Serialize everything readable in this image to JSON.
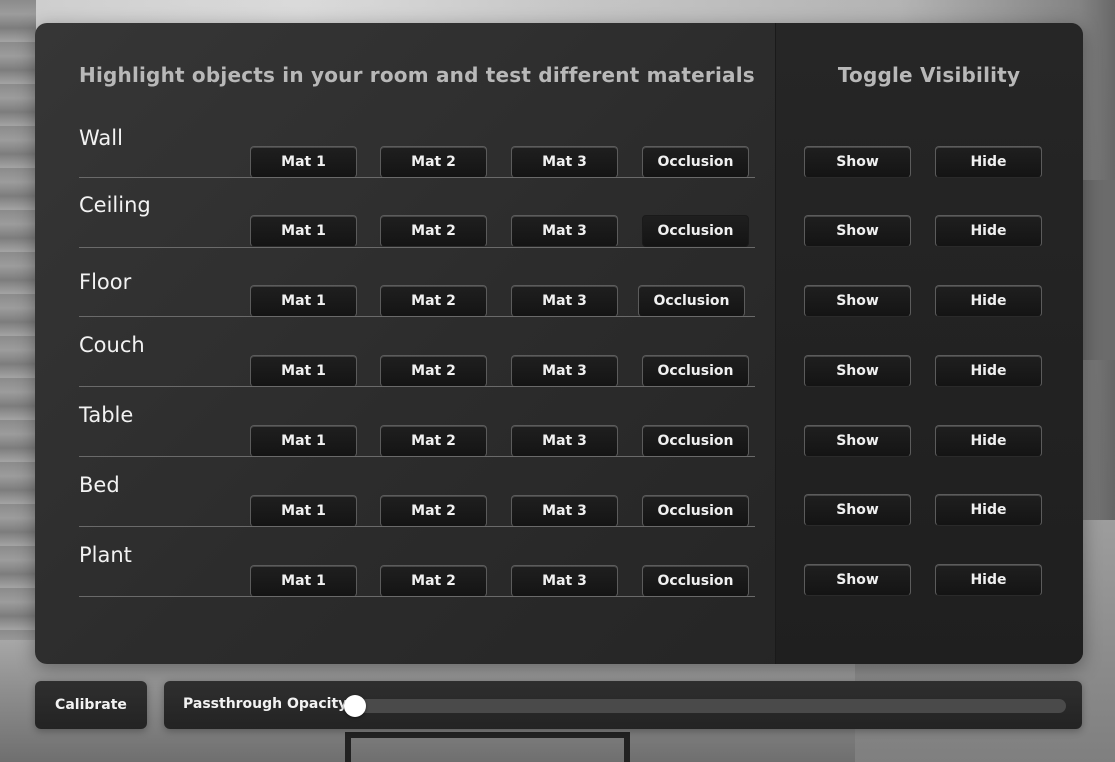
{
  "headings": {
    "materials": "Highlight objects in your room and test different materials",
    "visibility": "Toggle Visibility"
  },
  "rows": [
    {
      "label": "Wall",
      "mat1": "Mat 1",
      "mat2": "Mat 2",
      "mat3": "Mat 3",
      "occlusion": "Occlusion",
      "show": "Show",
      "hide": "Hide"
    },
    {
      "label": "Ceiling",
      "mat1": "Mat 1",
      "mat2": "Mat 2",
      "mat3": "Mat 3",
      "occlusion": "Occlusion",
      "show": "Show",
      "hide": "Hide"
    },
    {
      "label": "Floor",
      "mat1": "Mat 1",
      "mat2": "Mat 2",
      "mat3": "Mat 3",
      "occlusion": "Occlusion",
      "show": "Show",
      "hide": "Hide"
    },
    {
      "label": "Couch",
      "mat1": "Mat 1",
      "mat2": "Mat 2",
      "mat3": "Mat 3",
      "occlusion": "Occlusion",
      "show": "Show",
      "hide": "Hide"
    },
    {
      "label": "Table",
      "mat1": "Mat 1",
      "mat2": "Mat 2",
      "mat3": "Mat 3",
      "occlusion": "Occlusion",
      "show": "Show",
      "hide": "Hide"
    },
    {
      "label": "Bed",
      "mat1": "Mat 1",
      "mat2": "Mat 2",
      "mat3": "Mat 3",
      "occlusion": "Occlusion",
      "show": "Show",
      "hide": "Hide"
    },
    {
      "label": "Plant",
      "mat1": "Mat 1",
      "mat2": "Mat 2",
      "mat3": "Mat 3",
      "occlusion": "Occlusion",
      "show": "Show",
      "hide": "Hide"
    }
  ],
  "footer": {
    "calibrate_label": "Calibrate",
    "opacity_label": "Passthrough Opacity",
    "opacity_value": 0.0
  },
  "colors": {
    "panel": "#2c2c2c",
    "heading_text": "#b8b8b8",
    "button_bg": "#161616",
    "button_border": "#5c5c5c",
    "slider_thumb": "#ffffff"
  }
}
